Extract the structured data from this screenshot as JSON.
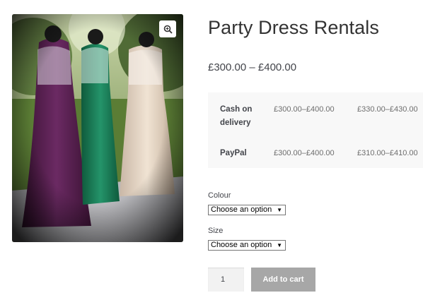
{
  "product": {
    "title": "Party Dress Rentals",
    "price_range": "£300.00 – £400.00",
    "image_alt": "Three formal dresses on mannequins"
  },
  "payment_table": {
    "rows": [
      {
        "method_line1": "Cash on",
        "method_line2": "delivery",
        "price_a": "£300.00–£400.00",
        "price_b": "£330.00–£430.00"
      },
      {
        "method_line1": "PayPal",
        "method_line2": "",
        "price_a": "£300.00–£400.00",
        "price_b": "£310.00–£410.00"
      }
    ]
  },
  "options": {
    "colour_label": "Colour",
    "colour_value": "Choose an option",
    "size_label": "Size",
    "size_value": "Choose an option"
  },
  "cart": {
    "quantity": "1",
    "add_label": "Add to cart"
  },
  "icons": {
    "zoom": "zoom-icon",
    "dropdown": "dropdown-arrow-icon"
  },
  "colors": {
    "button_bg": "#a7a7a7",
    "table_bg": "#f8f8f8"
  }
}
